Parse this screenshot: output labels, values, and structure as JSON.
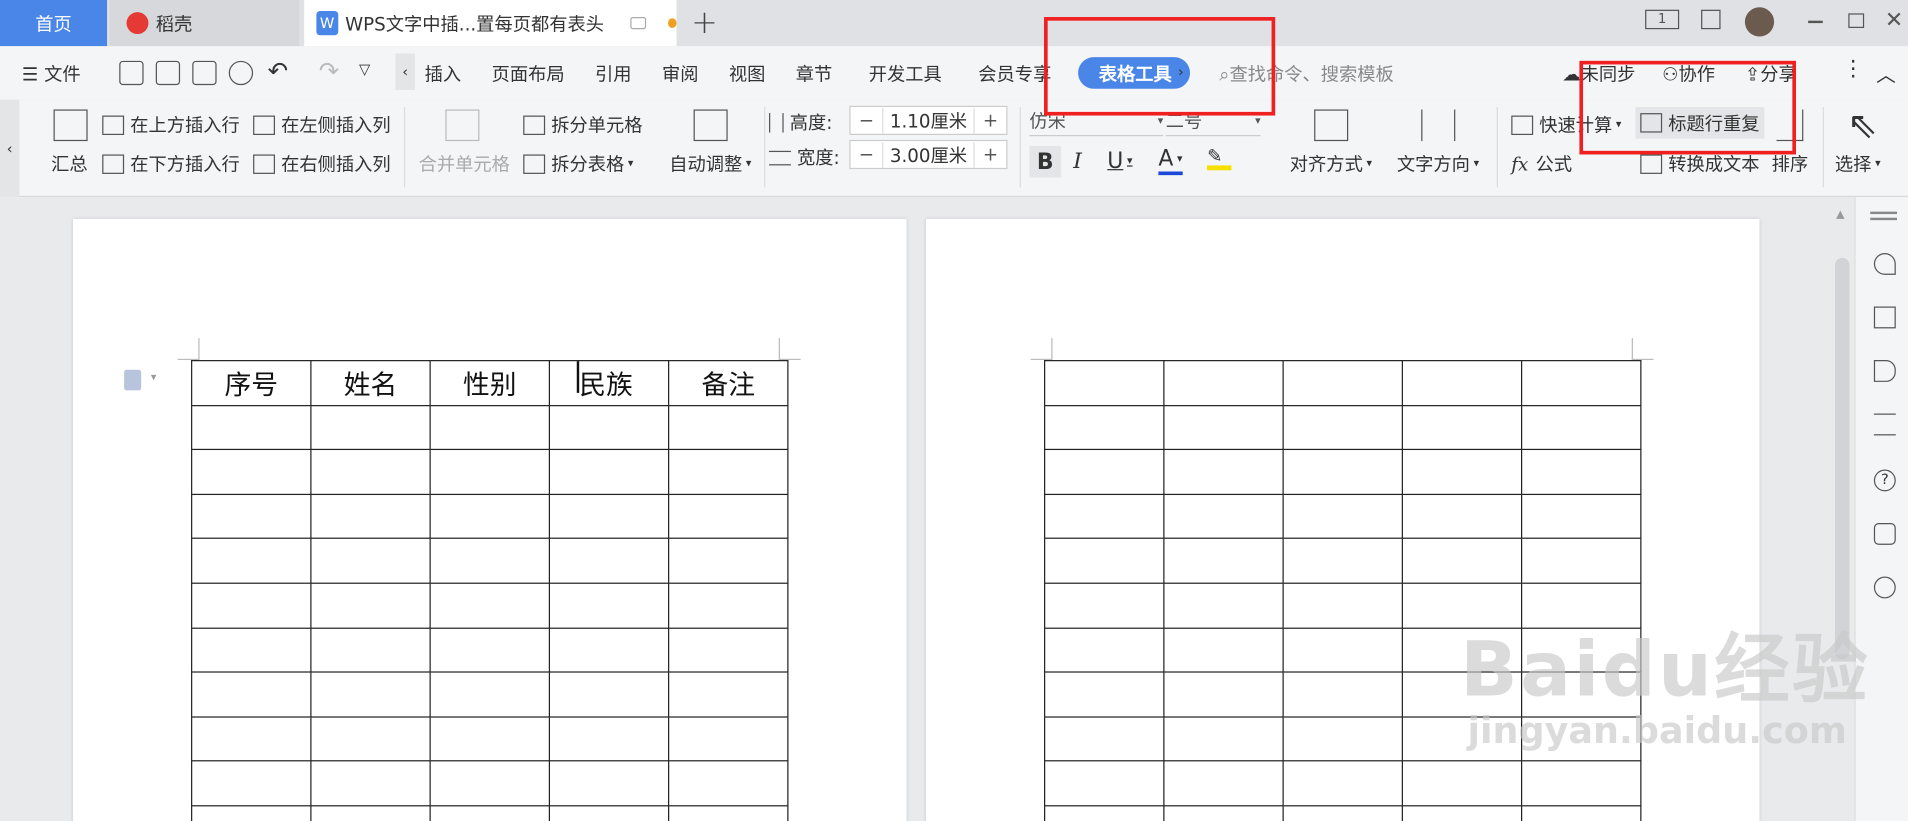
{
  "tabs": {
    "home": "首页",
    "daoke": "稻壳",
    "doc": "WPS文字中插...置每页都有表头",
    "add": "+"
  },
  "window": {
    "page_indicator": "1"
  },
  "menu": {
    "file": "文件",
    "items": [
      "插入",
      "页面布局",
      "引用",
      "审阅",
      "视图",
      "章节",
      "开发工具",
      "会员专享"
    ],
    "table_tools": "表格工具",
    "search_placeholder": "查找命令、搜索模板",
    "unsynced": "未同步",
    "collaborate": "协作",
    "share": "分享"
  },
  "ribbon": {
    "summary": "汇总",
    "insert_row_above": "在上方插入行",
    "insert_row_below": "在下方插入行",
    "insert_col_left": "在左侧插入列",
    "insert_col_right": "在右侧插入列",
    "merge_cells": "合并单元格",
    "split_cells": "拆分单元格",
    "split_table": "拆分表格",
    "auto_adjust": "自动调整",
    "height_label": "高度:",
    "height_value": "1.10厘米",
    "width_label": "宽度:",
    "width_value": "3.00厘米",
    "font_name": "仿宋",
    "font_size": "二号",
    "bold": "B",
    "italic": "I",
    "underline": "U",
    "font_color": "A",
    "align": "对齐方式",
    "text_direction": "文字方向",
    "quick_calc": "快速计算",
    "formula": "公式",
    "formula_icon": "fx",
    "repeat_header": "标题行重复",
    "convert_text": "转换成文本",
    "sort": "排序",
    "select": "选择"
  },
  "table": {
    "headers": [
      "序号",
      "姓名",
      "性别",
      "民族",
      "备注"
    ]
  },
  "watermark": {
    "brand": "Baidu经验",
    "url": "jingyan.baidu.com"
  },
  "colors": {
    "accent": "#4a86e8",
    "highlight": "#f02020"
  }
}
